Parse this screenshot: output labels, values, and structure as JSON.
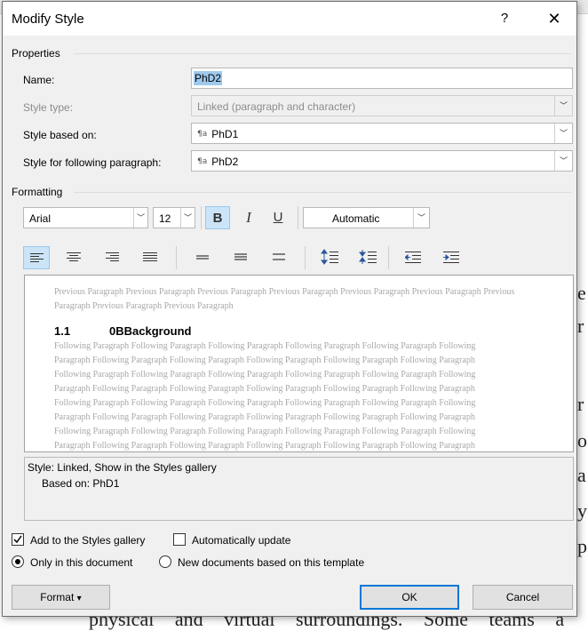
{
  "dialog": {
    "title": "Modify Style",
    "help_glyph": "?",
    "close_glyph": "✕"
  },
  "properties": {
    "group_label": "Properties",
    "name_label": "Name:",
    "name_value": "PhD2",
    "style_type_label": "Style type:",
    "style_type_value": "Linked (paragraph and character)",
    "based_on_label": "Style based on:",
    "based_on_value": "PhD1",
    "following_label": "Style for following paragraph:",
    "following_value": "PhD2"
  },
  "formatting": {
    "group_label": "Formatting",
    "font": "Arial",
    "size": "12",
    "bold": "B",
    "italic": "I",
    "underline": "U",
    "color": "Automatic",
    "bold_active": true
  },
  "preview": {
    "previous_text": "Previous Paragraph Previous Paragraph Previous Paragraph Previous Paragraph Previous Paragraph Previous Paragraph Previous Paragraph Previous Paragraph Previous Paragraph",
    "heading_number": "1.1",
    "heading_text": "0BBackground",
    "following_text": "Following Paragraph Following Paragraph Following Paragraph Following Paragraph Following Paragraph Following Paragraph Following Paragraph Following Paragraph Following Paragraph Following Paragraph Following Paragraph Following Paragraph Following Paragraph Following Paragraph Following Paragraph Following Paragraph Following Paragraph Following Paragraph Following Paragraph Following Paragraph Following Paragraph Following Paragraph Following Paragraph Following Paragraph Following Paragraph Following Paragraph Following Paragraph Following Paragraph Following Paragraph Following Paragraph Following Paragraph Following Paragraph Following Paragraph Following Paragraph Following Paragraph Following Paragraph Following Paragraph Following Paragraph Following Paragraph Following Paragraph Following Paragraph Following Paragraph Following Paragraph Following Paragraph Following Paragraph Following Paragraph Following Paragraph Following Paragraph Following Paragraph Following Paragraph Following Paragraph Following Paragraph Following Paragraph Following Paragraph Following Paragraph Following Paragraph Following Paragraph Following Paragraph Following Paragraph Following Paragraph Following Paragraph Following Paragraph Following Paragraph Following Paragraph Following Paragraph Following Paragraph Following Paragraph Following Paragraph Following Paragraph Following Paragraph Following Paragraph Following Paragraph Following Paragraph Following Paragraph Following Paragraph"
  },
  "description": {
    "line1": "Style: Linked, Show in the Styles gallery",
    "line2": "Based on: PhD1"
  },
  "options": {
    "add_to_gallery": "Add to the Styles gallery",
    "add_to_gallery_checked": true,
    "auto_update": "Automatically update",
    "auto_update_checked": false,
    "only_this_doc": "Only in this document",
    "new_docs": "New documents based on this template",
    "selected_scope": "Only in this document"
  },
  "buttons": {
    "format": "Format",
    "format_arrow": "▾",
    "ok": "OK",
    "cancel": "Cancel"
  },
  "background_doc": {
    "chars": [
      "e",
      "r",
      "r",
      "o",
      "a",
      "y",
      "p"
    ],
    "bottom_text": "physical and virtual surroundings. Some teams a"
  },
  "colors": {
    "accent": "#0078d7",
    "selection": "#cce4f7",
    "dialog_bg": "#f0f0f0"
  }
}
